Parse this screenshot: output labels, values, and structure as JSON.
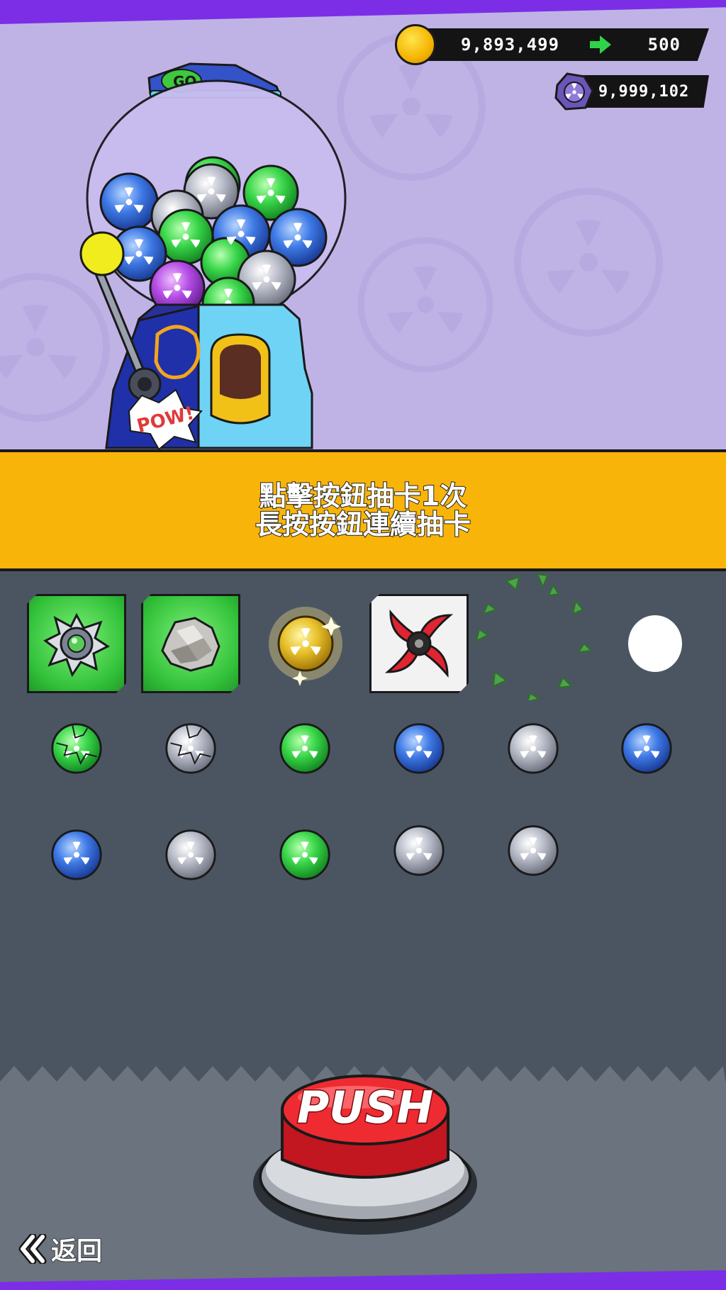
{
  "currency": {
    "coins": "9,893,499",
    "coin_bonus": "500",
    "gems": "9,999,102"
  },
  "instructions": {
    "line1": "點擊按鈕抽卡1次",
    "line2": "長按按鈕連續抽卡"
  },
  "machine": {
    "sticker_pow": "POW!",
    "sticker_go": "GO"
  },
  "rewards_row1": [
    {
      "kind": "card",
      "frame": "green",
      "icon": "spiked-shield-icon"
    },
    {
      "kind": "card",
      "frame": "green",
      "icon": "rock-icon"
    },
    {
      "kind": "capsule",
      "color": "gold",
      "icon": "gold-capsule-icon"
    },
    {
      "kind": "card",
      "frame": "white",
      "icon": "red-shuriken-icon"
    },
    {
      "kind": "effect",
      "icon": "burst-fragments-icon"
    },
    {
      "kind": "flash",
      "icon": "white-flash-icon"
    }
  ],
  "capsules_row2": [
    "green-cracked",
    "silver-cracked",
    "green",
    "blue",
    "silver",
    "blue"
  ],
  "capsules_row3": [
    "blue",
    "silver",
    "green",
    "silver",
    "silver"
  ],
  "push_button": {
    "label": "PUSH"
  },
  "back_button": {
    "label": "返回"
  },
  "colors": {
    "background_top": "#bfb3e6",
    "band": "#f9b40a",
    "panel": "#4b5562",
    "accent_purple": "#7b2ee6",
    "arrow_green": "#2fd34a"
  }
}
